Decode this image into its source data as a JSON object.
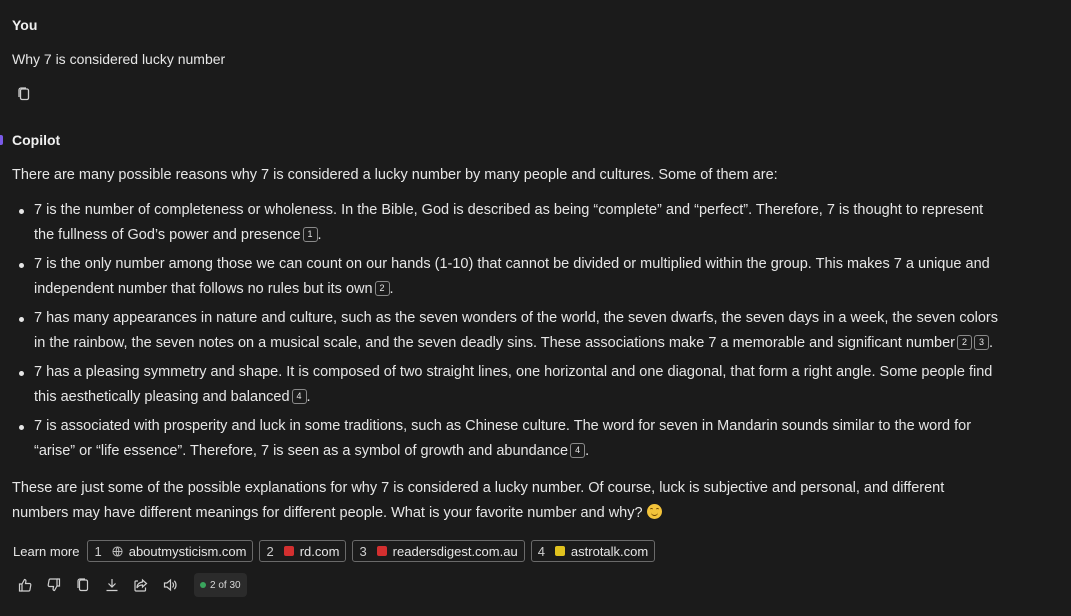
{
  "user": {
    "name": "You",
    "message": "Why 7 is considered lucky number"
  },
  "copilot": {
    "name": "Copilot",
    "intro": "There are many possible reasons why 7 is considered a lucky number by many people and cultures. Some of them are:",
    "bullets": [
      {
        "text_a": "7 is the number of completeness or wholeness. In the Bible, God is described as being “complete” and “perfect”. Therefore, 7 is thought to represent the fullness of God’s power and presence",
        "cites": [
          "1"
        ]
      },
      {
        "text_a": "7 is the only number among those we can count on our hands (1-10) that cannot be divided or multiplied within the group. This makes 7 a unique and independent number that follows no rules but its own",
        "cites": [
          "2"
        ]
      },
      {
        "text_a": "7 has many appearances in nature and culture, such as the seven wonders of the world, the seven dwarfs, the seven days in a week, the seven colors in the rainbow, the seven notes on a musical scale, and the seven deadly sins. These associations make 7 a memorable and significant number",
        "cites": [
          "2",
          "3"
        ]
      },
      {
        "text_a": "7 has a pleasing symmetry and shape. It is composed of two straight lines, one horizontal and one diagonal, that form a right angle. Some people find this aesthetically pleasing and balanced",
        "cites": [
          "4"
        ]
      },
      {
        "text_a": "7 is associated with prosperity and luck in some traditions, such as Chinese culture. The word for seven in Mandarin sounds similar to the word for “arise” or “life essence”. Therefore, 7 is seen as a symbol of growth and abundance",
        "cites": [
          "4"
        ]
      }
    ],
    "outro": "These are just some of the possible explanations for why 7 is considered a lucky number. Of course, luck is subjective and personal, and different numbers may have different meanings for different people. What is your favorite number and why?",
    "learn_more": {
      "label": "Learn more",
      "sources": [
        {
          "num": "1",
          "domain": "aboutmysticism.com",
          "icon": "globe-icon",
          "color": "#9a9a9a"
        },
        {
          "num": "2",
          "domain": "rd.com",
          "icon": "rd-logo-icon",
          "color": "#d32f2f"
        },
        {
          "num": "3",
          "domain": "readersdigest.com.au",
          "icon": "rd-logo-icon",
          "color": "#d32f2f"
        },
        {
          "num": "4",
          "domain": "astrotalk.com",
          "icon": "astrotalk-logo-icon",
          "color": "#e0c21e"
        }
      ]
    },
    "counter": {
      "text": "2 of 30",
      "dot_color": "#3aa55d"
    }
  },
  "colors": {
    "background": "#1b1b1b",
    "text": "#e6e6e6",
    "accent": "#7a5ae8"
  }
}
